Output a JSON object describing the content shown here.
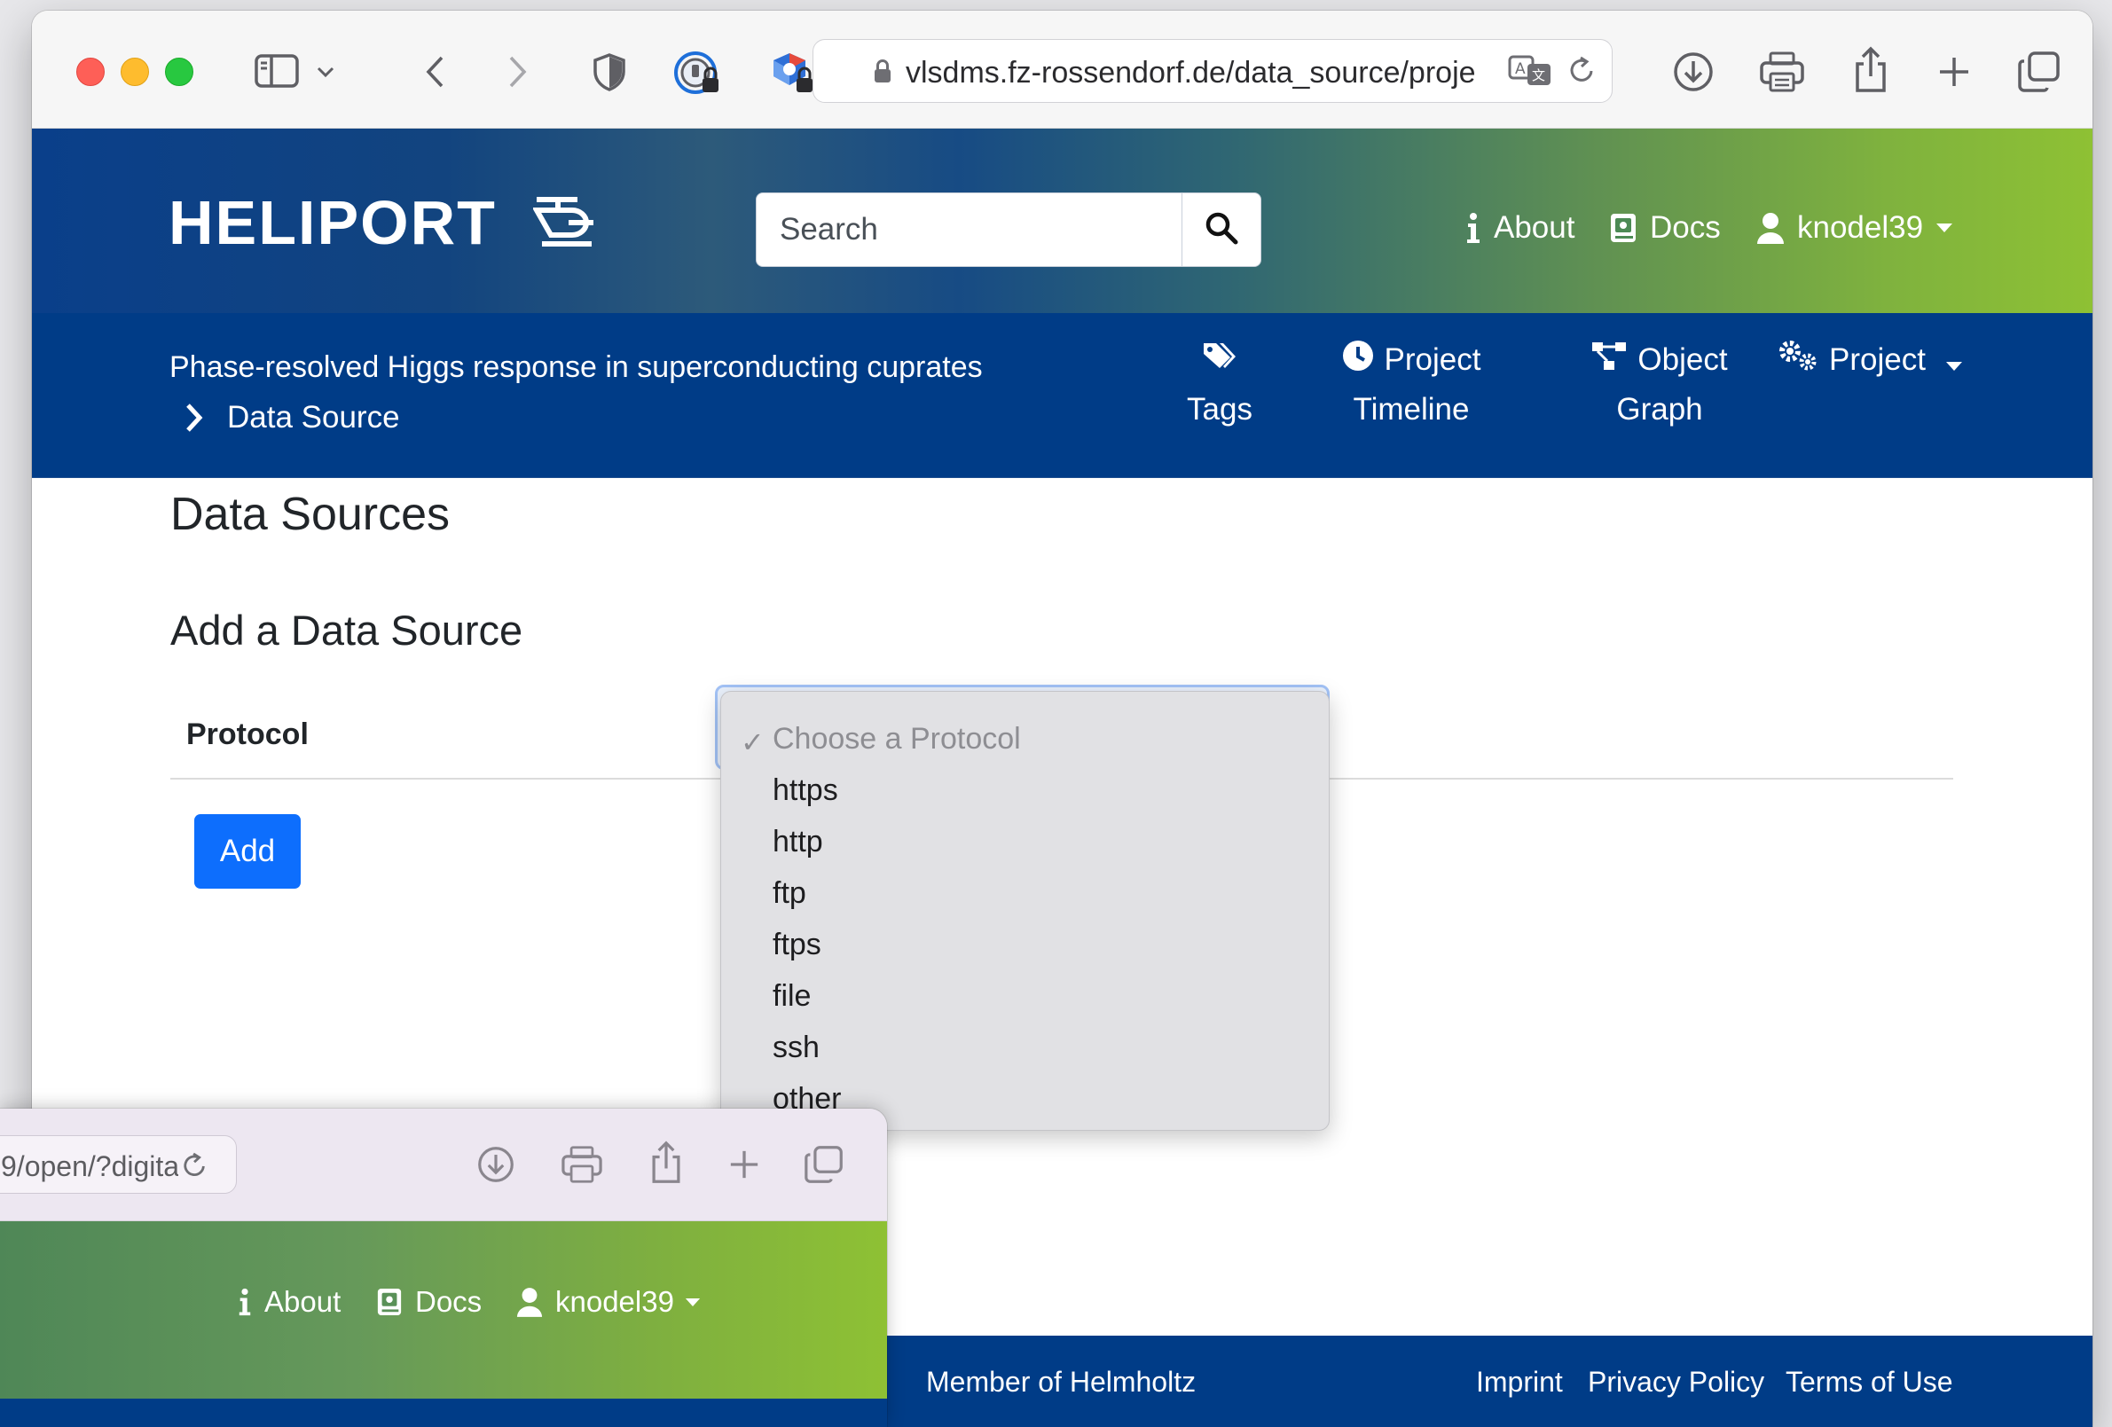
{
  "browser": {
    "url": "vlsdms.fz-rossendorf.de/data_source/proje",
    "icons": [
      "sidebar-icon",
      "chevron-down-icon",
      "back-icon",
      "forward-icon",
      "shield-icon",
      "password-icon",
      "extension-icon",
      "lock-icon",
      "translate-icon",
      "reload-icon",
      "download-icon",
      "print-icon",
      "share-icon",
      "new-tab-icon",
      "tabs-overview-icon"
    ]
  },
  "header": {
    "logo": "HELIPORT",
    "search_placeholder": "Search",
    "nav": {
      "about": "About",
      "docs": "Docs",
      "user": "knodel39"
    }
  },
  "subnav": {
    "project_title": "Phase-resolved Higgs response in superconducting cuprates",
    "breadcrumb": "Data Source",
    "items": {
      "tags": "Tags",
      "timeline_l1": "Project",
      "timeline_l2": "Timeline",
      "graph_l1": "Object",
      "graph_l2": "Graph",
      "project": "Project"
    }
  },
  "main": {
    "title": "Data Sources",
    "subtitle": "Add a Data Source",
    "protocol_label": "Protocol",
    "add_button": "Add",
    "select": {
      "selected": "Choose a Protocol",
      "check": "✓",
      "options": [
        "https",
        "http",
        "ftp",
        "ftps",
        "file",
        "ssh",
        "other"
      ]
    }
  },
  "footer": {
    "member": "Member of Helmholtz",
    "imprint": "Imprint",
    "privacy": "Privacy Policy",
    "terms": "Terms of Use"
  },
  "background_window": {
    "url": "9/open/?digita",
    "nav": {
      "about": "About",
      "docs": "Docs",
      "user": "knodel39"
    }
  },
  "colors": {
    "brand_blue": "#003c87",
    "brand_green": "#8ec134",
    "button_blue": "#0d6efd"
  }
}
